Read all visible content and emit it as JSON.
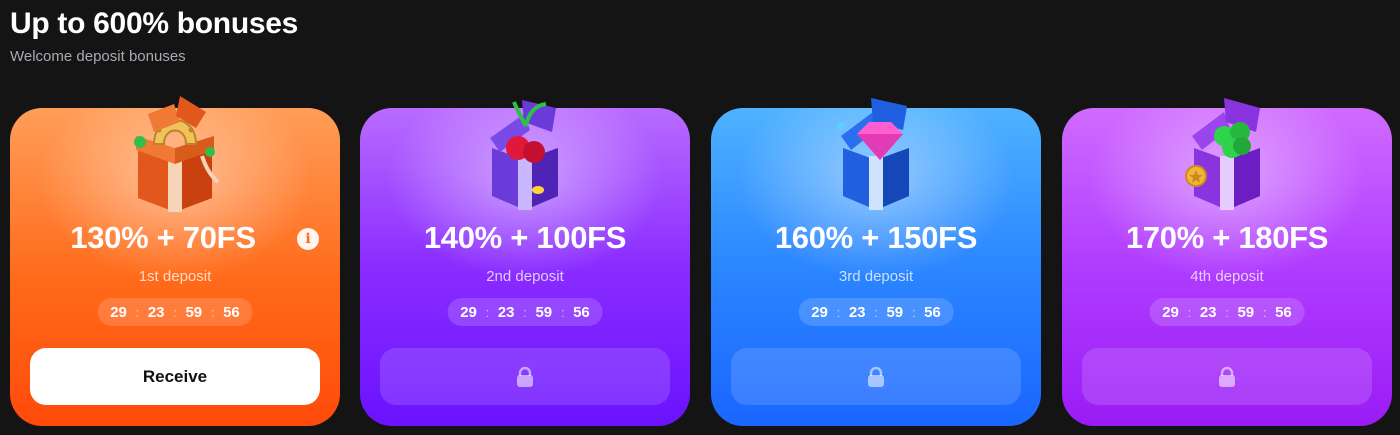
{
  "header": {
    "title": "Up to 600% bonuses",
    "subtitle": "Welcome deposit bonuses"
  },
  "cards": [
    {
      "amount": "130% + 70FS",
      "deposit": "1st deposit",
      "timer": [
        "29",
        "23",
        "59",
        "56"
      ],
      "button_label": "Receive",
      "locked": false,
      "gift_icon": "horseshoe-gift-icon",
      "color": "#ff6a1a"
    },
    {
      "amount": "140% + 100FS",
      "deposit": "2nd deposit",
      "timer": [
        "29",
        "23",
        "59",
        "56"
      ],
      "locked": true,
      "gift_icon": "cherry-gift-icon",
      "color": "#8a2cff"
    },
    {
      "amount": "160% + 150FS",
      "deposit": "3rd deposit",
      "timer": [
        "29",
        "23",
        "59",
        "56"
      ],
      "locked": true,
      "gift_icon": "diamond-gift-icon",
      "color": "#2b86ff"
    },
    {
      "amount": "170% + 180FS",
      "deposit": "4th deposit",
      "timer": [
        "29",
        "23",
        "59",
        "56"
      ],
      "locked": true,
      "gift_icon": "clover-gift-icon",
      "color": "#b03cff"
    }
  ]
}
